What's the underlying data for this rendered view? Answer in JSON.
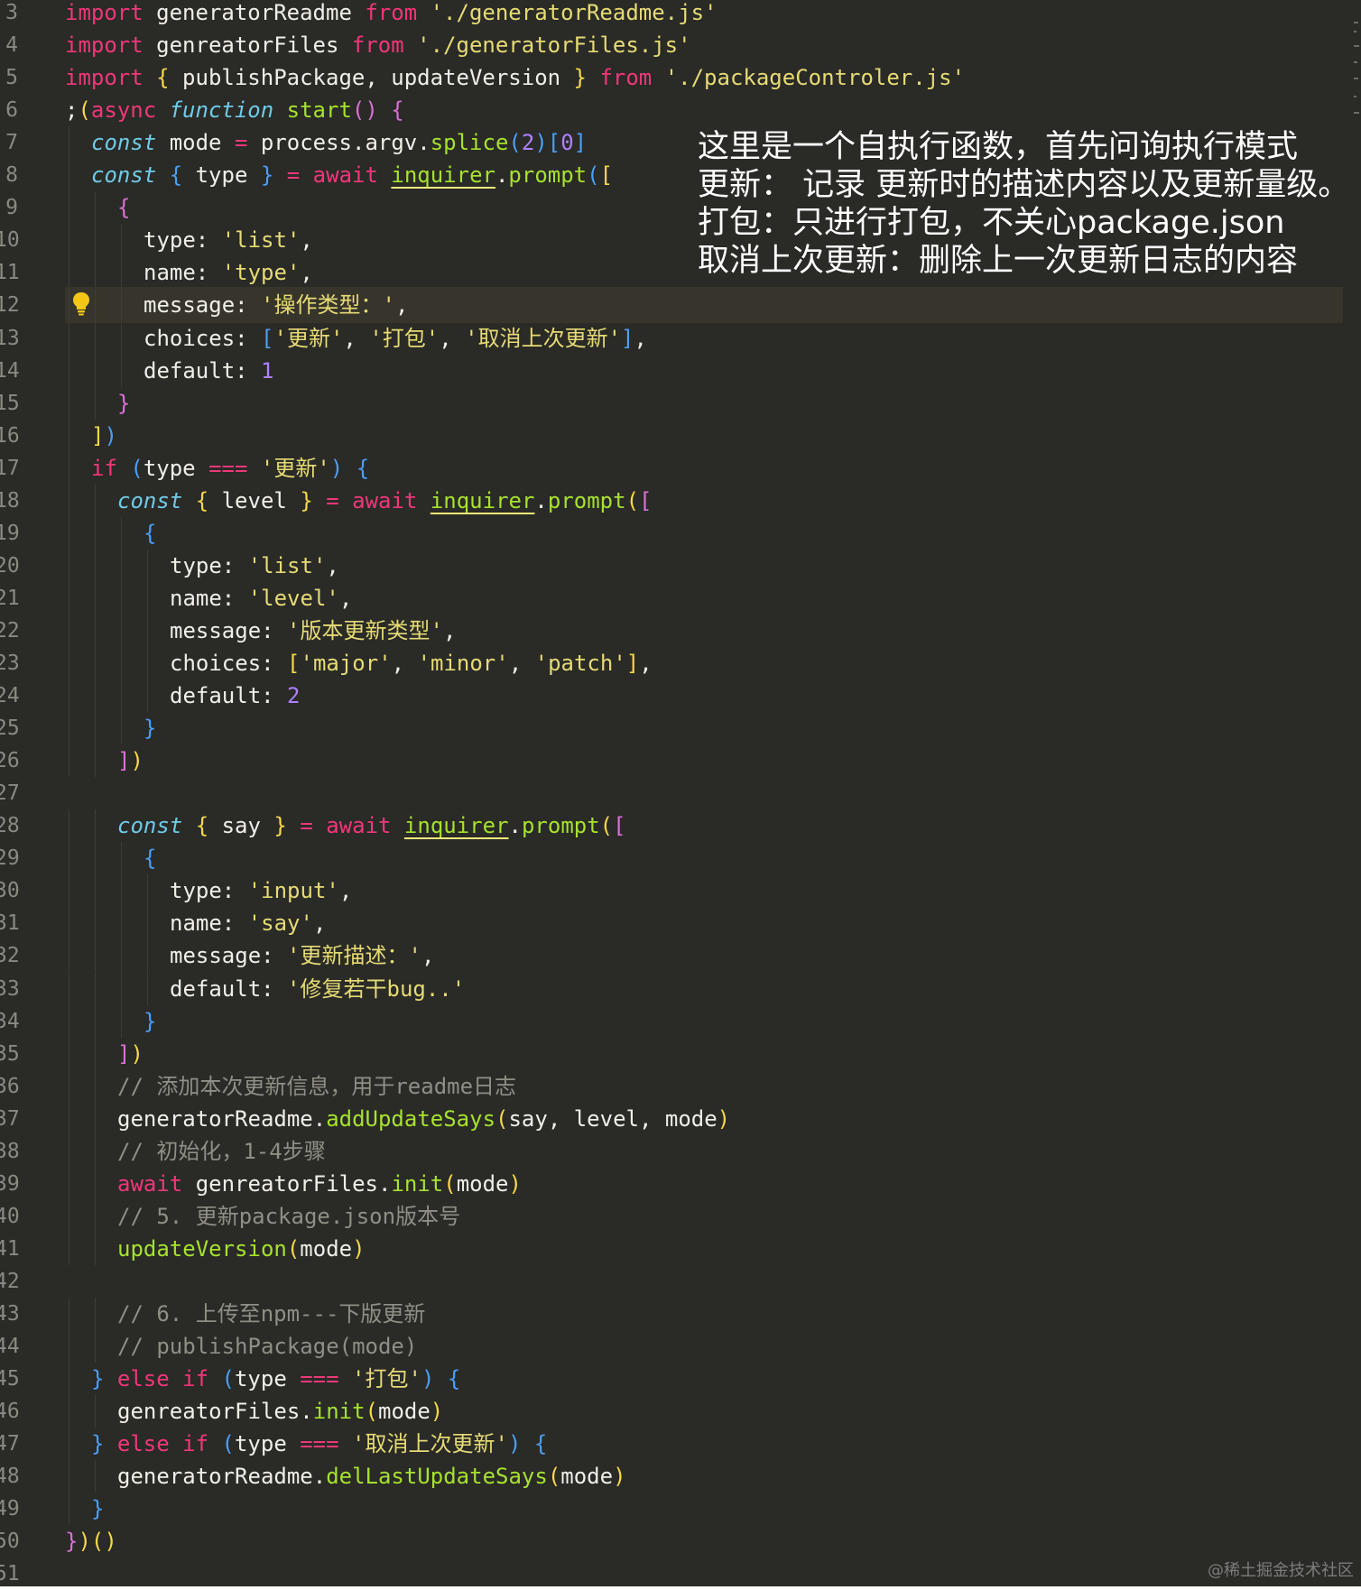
{
  "colors": {
    "background": "#2a2a27",
    "foreground": "#f0efe7",
    "keyword": "#f0377a",
    "storage": "#6fcbe8",
    "function_name": "#a6e22e",
    "string": "#e6db74",
    "number": "#ae81ff",
    "comment": "#8f8f86",
    "bracket_yellow": "#f7d84a",
    "bracket_magenta": "#da70d6",
    "bracket_blue": "#4a9ff5"
  },
  "editor": {
    "lines": [
      {
        "n": "3",
        "indent": 0,
        "tokens": [
          [
            "import",
            "keyword"
          ],
          [
            " generatorReadme ",
            "plain"
          ],
          [
            "from",
            "keyword"
          ],
          [
            " ",
            "plain"
          ],
          [
            "'./generatorReadme.js'",
            "string"
          ]
        ]
      },
      {
        "n": "4",
        "indent": 0,
        "tokens": [
          [
            "import",
            "keyword"
          ],
          [
            " genreatorFiles ",
            "plain"
          ],
          [
            "from",
            "keyword"
          ],
          [
            " ",
            "plain"
          ],
          [
            "'./generatorFiles.js'",
            "string"
          ]
        ]
      },
      {
        "n": "5",
        "indent": 0,
        "tokens": [
          [
            "import",
            "keyword"
          ],
          [
            " ",
            "plain"
          ],
          [
            "{",
            "bracket_yellow"
          ],
          [
            " publishPackage, updateVersion ",
            "plain"
          ],
          [
            "}",
            "bracket_yellow"
          ],
          [
            " ",
            "plain"
          ],
          [
            "from",
            "keyword"
          ],
          [
            " ",
            "plain"
          ],
          [
            "'./packageControler.js'",
            "string"
          ]
        ]
      },
      {
        "n": "6",
        "indent": 0,
        "tokens": [
          [
            ";",
            "plain"
          ],
          [
            "(",
            "bracket_yellow"
          ],
          [
            "async",
            "keyword"
          ],
          [
            " ",
            "plain"
          ],
          [
            "function",
            "storage_it"
          ],
          [
            " ",
            "plain"
          ],
          [
            "start",
            "function_name"
          ],
          [
            "()",
            "bracket_magenta"
          ],
          [
            " ",
            "plain"
          ],
          [
            "{",
            "bracket_magenta"
          ]
        ]
      },
      {
        "n": "7",
        "indent": 1,
        "tokens": [
          [
            "const",
            "storage_it"
          ],
          [
            " mode ",
            "plain"
          ],
          [
            "=",
            "keyword"
          ],
          [
            " process.argv.",
            "plain"
          ],
          [
            "splice",
            "function_name"
          ],
          [
            "(",
            "bracket_blue"
          ],
          [
            "2",
            "number"
          ],
          [
            ")",
            "bracket_blue"
          ],
          [
            "[",
            "bracket_blue"
          ],
          [
            "0",
            "number"
          ],
          [
            "]",
            "bracket_blue"
          ]
        ]
      },
      {
        "n": "8",
        "indent": 1,
        "tokens": [
          [
            "const",
            "storage_it"
          ],
          [
            " ",
            "plain"
          ],
          [
            "{",
            "bracket_blue"
          ],
          [
            " type ",
            "plain"
          ],
          [
            "}",
            "bracket_blue"
          ],
          [
            " ",
            "plain"
          ],
          [
            "=",
            "keyword"
          ],
          [
            " ",
            "plain"
          ],
          [
            "await",
            "keyword"
          ],
          [
            " ",
            "plain"
          ],
          [
            "inquirer",
            "function_ul"
          ],
          [
            ".",
            "plain"
          ],
          [
            "prompt",
            "function_name"
          ],
          [
            "(",
            "bracket_blue"
          ],
          [
            "[",
            "bracket_yellow"
          ]
        ]
      },
      {
        "n": "9",
        "indent": 2,
        "tokens": [
          [
            "{",
            "bracket_magenta"
          ]
        ]
      },
      {
        "n": "10",
        "indent": 3,
        "tokens": [
          [
            "type: ",
            "plain"
          ],
          [
            "'list'",
            "string"
          ],
          [
            ",",
            "plain"
          ]
        ]
      },
      {
        "n": "11",
        "indent": 3,
        "tokens": [
          [
            "name: ",
            "plain"
          ],
          [
            "'type'",
            "string"
          ],
          [
            ",",
            "plain"
          ]
        ]
      },
      {
        "n": "12",
        "indent": 3,
        "hl": true,
        "tokens": [
          [
            "message: ",
            "plain"
          ],
          [
            "'操作类型：'",
            "string"
          ],
          [
            ",",
            "plain"
          ]
        ]
      },
      {
        "n": "13",
        "indent": 3,
        "tokens": [
          [
            "choices: ",
            "plain"
          ],
          [
            "[",
            "bracket_blue"
          ],
          [
            "'更新'",
            "string"
          ],
          [
            ", ",
            "plain"
          ],
          [
            "'打包'",
            "string"
          ],
          [
            ", ",
            "plain"
          ],
          [
            "'取消上次更新'",
            "string"
          ],
          [
            "]",
            "bracket_blue"
          ],
          [
            ",",
            "plain"
          ]
        ]
      },
      {
        "n": "14",
        "indent": 3,
        "tokens": [
          [
            "default: ",
            "plain"
          ],
          [
            "1",
            "number"
          ]
        ]
      },
      {
        "n": "15",
        "indent": 2,
        "tokens": [
          [
            "}",
            "bracket_magenta"
          ]
        ]
      },
      {
        "n": "16",
        "indent": 1,
        "tokens": [
          [
            "]",
            "bracket_yellow"
          ],
          [
            ")",
            "bracket_blue"
          ]
        ]
      },
      {
        "n": "17",
        "indent": 1,
        "tokens": [
          [
            "if",
            "keyword"
          ],
          [
            " ",
            "plain"
          ],
          [
            "(",
            "bracket_blue"
          ],
          [
            "type ",
            "plain"
          ],
          [
            "===",
            "keyword"
          ],
          [
            " ",
            "plain"
          ],
          [
            "'更新'",
            "string"
          ],
          [
            ")",
            "bracket_blue"
          ],
          [
            " ",
            "plain"
          ],
          [
            "{",
            "bracket_blue"
          ]
        ]
      },
      {
        "n": "18",
        "indent": 2,
        "tokens": [
          [
            "const",
            "storage_it"
          ],
          [
            " ",
            "plain"
          ],
          [
            "{",
            "bracket_yellow"
          ],
          [
            " level ",
            "plain"
          ],
          [
            "}",
            "bracket_yellow"
          ],
          [
            " ",
            "plain"
          ],
          [
            "=",
            "keyword"
          ],
          [
            " ",
            "plain"
          ],
          [
            "await",
            "keyword"
          ],
          [
            " ",
            "plain"
          ],
          [
            "inquirer",
            "function_ul"
          ],
          [
            ".",
            "plain"
          ],
          [
            "prompt",
            "function_name"
          ],
          [
            "(",
            "bracket_yellow"
          ],
          [
            "[",
            "bracket_magenta"
          ]
        ]
      },
      {
        "n": "19",
        "indent": 3,
        "tokens": [
          [
            "{",
            "bracket_blue"
          ]
        ]
      },
      {
        "n": "20",
        "indent": 4,
        "tokens": [
          [
            "type: ",
            "plain"
          ],
          [
            "'list'",
            "string"
          ],
          [
            ",",
            "plain"
          ]
        ]
      },
      {
        "n": "21",
        "indent": 4,
        "tokens": [
          [
            "name: ",
            "plain"
          ],
          [
            "'level'",
            "string"
          ],
          [
            ",",
            "plain"
          ]
        ]
      },
      {
        "n": "22",
        "indent": 4,
        "tokens": [
          [
            "message: ",
            "plain"
          ],
          [
            "'版本更新类型'",
            "string"
          ],
          [
            ",",
            "plain"
          ]
        ]
      },
      {
        "n": "23",
        "indent": 4,
        "tokens": [
          [
            "choices: ",
            "plain"
          ],
          [
            "[",
            "bracket_yellow"
          ],
          [
            "'major'",
            "string"
          ],
          [
            ", ",
            "plain"
          ],
          [
            "'minor'",
            "string"
          ],
          [
            ", ",
            "plain"
          ],
          [
            "'patch'",
            "string"
          ],
          [
            "]",
            "bracket_yellow"
          ],
          [
            ",",
            "plain"
          ]
        ]
      },
      {
        "n": "24",
        "indent": 4,
        "tokens": [
          [
            "default: ",
            "plain"
          ],
          [
            "2",
            "number"
          ]
        ]
      },
      {
        "n": "25",
        "indent": 3,
        "tokens": [
          [
            "}",
            "bracket_blue"
          ]
        ]
      },
      {
        "n": "26",
        "indent": 2,
        "tokens": [
          [
            "]",
            "bracket_magenta"
          ],
          [
            ")",
            "bracket_yellow"
          ]
        ]
      },
      {
        "n": "27",
        "indent": 0,
        "tokens": []
      },
      {
        "n": "28",
        "indent": 2,
        "tokens": [
          [
            "const",
            "storage_it"
          ],
          [
            " ",
            "plain"
          ],
          [
            "{",
            "bracket_yellow"
          ],
          [
            " say ",
            "plain"
          ],
          [
            "}",
            "bracket_yellow"
          ],
          [
            " ",
            "plain"
          ],
          [
            "=",
            "keyword"
          ],
          [
            " ",
            "plain"
          ],
          [
            "await",
            "keyword"
          ],
          [
            " ",
            "plain"
          ],
          [
            "inquirer",
            "function_ul"
          ],
          [
            ".",
            "plain"
          ],
          [
            "prompt",
            "function_name"
          ],
          [
            "(",
            "bracket_yellow"
          ],
          [
            "[",
            "bracket_magenta"
          ]
        ]
      },
      {
        "n": "29",
        "indent": 3,
        "tokens": [
          [
            "{",
            "bracket_blue"
          ]
        ]
      },
      {
        "n": "30",
        "indent": 4,
        "tokens": [
          [
            "type: ",
            "plain"
          ],
          [
            "'input'",
            "string"
          ],
          [
            ",",
            "plain"
          ]
        ]
      },
      {
        "n": "31",
        "indent": 4,
        "tokens": [
          [
            "name: ",
            "plain"
          ],
          [
            "'say'",
            "string"
          ],
          [
            ",",
            "plain"
          ]
        ]
      },
      {
        "n": "32",
        "indent": 4,
        "tokens": [
          [
            "message: ",
            "plain"
          ],
          [
            "'更新描述：'",
            "string"
          ],
          [
            ",",
            "plain"
          ]
        ]
      },
      {
        "n": "33",
        "indent": 4,
        "tokens": [
          [
            "default: ",
            "plain"
          ],
          [
            "'修复若干bug..'",
            "string"
          ]
        ]
      },
      {
        "n": "34",
        "indent": 3,
        "tokens": [
          [
            "}",
            "bracket_blue"
          ]
        ]
      },
      {
        "n": "35",
        "indent": 2,
        "tokens": [
          [
            "]",
            "bracket_magenta"
          ],
          [
            ")",
            "bracket_yellow"
          ]
        ]
      },
      {
        "n": "36",
        "indent": 2,
        "tokens": [
          [
            "// 添加本次更新信息，用于readme日志",
            "comment"
          ]
        ]
      },
      {
        "n": "37",
        "indent": 2,
        "tokens": [
          [
            "generatorReadme.",
            "plain"
          ],
          [
            "addUpdateSays",
            "function_name"
          ],
          [
            "(",
            "bracket_yellow"
          ],
          [
            "say, level, mode",
            "plain"
          ],
          [
            ")",
            "bracket_yellow"
          ]
        ]
      },
      {
        "n": "38",
        "indent": 2,
        "tokens": [
          [
            "// 初始化，1-4步骤",
            "comment"
          ]
        ]
      },
      {
        "n": "39",
        "indent": 2,
        "tokens": [
          [
            "await",
            "keyword"
          ],
          [
            " genreatorFiles.",
            "plain"
          ],
          [
            "init",
            "function_name"
          ],
          [
            "(",
            "bracket_yellow"
          ],
          [
            "mode",
            "plain"
          ],
          [
            ")",
            "bracket_yellow"
          ]
        ]
      },
      {
        "n": "40",
        "indent": 2,
        "tokens": [
          [
            "// 5. 更新package.json版本号",
            "comment"
          ]
        ]
      },
      {
        "n": "41",
        "indent": 2,
        "tokens": [
          [
            "updateVersion",
            "function_name"
          ],
          [
            "(",
            "bracket_yellow"
          ],
          [
            "mode",
            "plain"
          ],
          [
            ")",
            "bracket_yellow"
          ]
        ]
      },
      {
        "n": "42",
        "indent": 0,
        "tokens": []
      },
      {
        "n": "43",
        "indent": 2,
        "tokens": [
          [
            "// 6. 上传至npm---下版更新",
            "comment"
          ]
        ]
      },
      {
        "n": "44",
        "indent": 2,
        "tokens": [
          [
            "// publishPackage(mode)",
            "comment"
          ]
        ]
      },
      {
        "n": "45",
        "indent": 1,
        "tokens": [
          [
            "}",
            "bracket_blue"
          ],
          [
            " ",
            "plain"
          ],
          [
            "else",
            "keyword"
          ],
          [
            " ",
            "plain"
          ],
          [
            "if",
            "keyword"
          ],
          [
            " ",
            "plain"
          ],
          [
            "(",
            "bracket_blue"
          ],
          [
            "type ",
            "plain"
          ],
          [
            "===",
            "keyword"
          ],
          [
            " ",
            "plain"
          ],
          [
            "'打包'",
            "string"
          ],
          [
            ")",
            "bracket_blue"
          ],
          [
            " ",
            "plain"
          ],
          [
            "{",
            "bracket_blue"
          ]
        ]
      },
      {
        "n": "46",
        "indent": 2,
        "tokens": [
          [
            "genreatorFiles.",
            "plain"
          ],
          [
            "init",
            "function_name"
          ],
          [
            "(",
            "bracket_yellow"
          ],
          [
            "mode",
            "plain"
          ],
          [
            ")",
            "bracket_yellow"
          ]
        ]
      },
      {
        "n": "47",
        "indent": 1,
        "tokens": [
          [
            "}",
            "bracket_blue"
          ],
          [
            " ",
            "plain"
          ],
          [
            "else",
            "keyword"
          ],
          [
            " ",
            "plain"
          ],
          [
            "if",
            "keyword"
          ],
          [
            " ",
            "plain"
          ],
          [
            "(",
            "bracket_blue"
          ],
          [
            "type ",
            "plain"
          ],
          [
            "===",
            "keyword"
          ],
          [
            " ",
            "plain"
          ],
          [
            "'取消上次更新'",
            "string"
          ],
          [
            ")",
            "bracket_blue"
          ],
          [
            " ",
            "plain"
          ],
          [
            "{",
            "bracket_blue"
          ]
        ]
      },
      {
        "n": "48",
        "indent": 2,
        "tokens": [
          [
            "generatorReadme.",
            "plain"
          ],
          [
            "delLastUpdateSays",
            "function_name"
          ],
          [
            "(",
            "bracket_yellow"
          ],
          [
            "mode",
            "plain"
          ],
          [
            ")",
            "bracket_yellow"
          ]
        ]
      },
      {
        "n": "49",
        "indent": 1,
        "tokens": [
          [
            "}",
            "bracket_blue"
          ]
        ]
      },
      {
        "n": "50",
        "indent": 0,
        "tokens": [
          [
            "}",
            "bracket_magenta"
          ],
          [
            ")",
            "bracket_yellow"
          ],
          [
            "()",
            "bracket_yellow"
          ]
        ]
      },
      {
        "n": "51",
        "indent": 0,
        "tokens": []
      }
    ]
  },
  "annotation": {
    "lines": [
      "这里是一个自执行函数，首先问询执行模式",
      "更新： 记录 更新时的描述内容以及更新量级。",
      "打包：只进行打包，不关心package.json",
      "取消上次更新：删除上一次更新日志的内容"
    ]
  },
  "icons": {
    "lightbulb": "lightbulb-icon"
  },
  "watermark": "@稀土掘金技术社区"
}
